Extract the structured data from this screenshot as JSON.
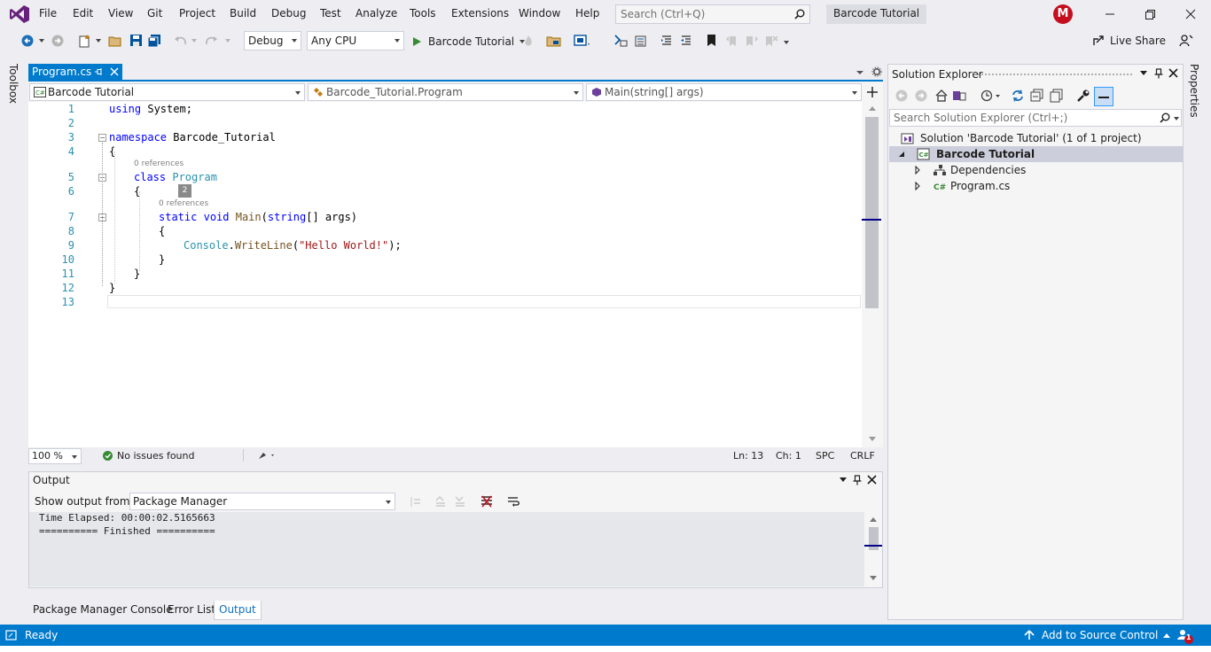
{
  "menu": {
    "items": [
      "File",
      "Edit",
      "View",
      "Git",
      "Project",
      "Build",
      "Debug",
      "Test",
      "Analyze",
      "Tools",
      "Extensions",
      "Window",
      "Help"
    ],
    "search_placeholder": "Search (Ctrl+Q)",
    "solution_name": "Barcode Tutorial",
    "avatar_initial": "M"
  },
  "toolbar": {
    "configuration": "Debug",
    "platform": "Any CPU",
    "run_target": "Barcode Tutorial",
    "live_share": "Live Share"
  },
  "side_strips": {
    "toolbox": "Toolbox",
    "properties": "Properties"
  },
  "editor": {
    "tab_label": "Program.cs",
    "nav_project": "Barcode Tutorial",
    "nav_type": "Barcode_Tutorial.Program",
    "nav_member": "Main(string[] args)",
    "line_numbers": [
      "1",
      "2",
      "3",
      "4",
      "5",
      "6",
      "7",
      "8",
      "9",
      "10",
      "11",
      "12",
      "13"
    ],
    "codelens_class": "0 references",
    "codelens_method": "0 references",
    "badge": "2",
    "code": {
      "l1_kw": "using",
      "l1_rest": " System;",
      "l3_kw": "namespace",
      "l3_rest": " Barcode_Tutorial",
      "l4": "{",
      "l5_kw": "class",
      "l5_type": "Program",
      "l6": "{",
      "l7_kw1": "static",
      "l7_kw2": "void",
      "l7_method": "Main",
      "l7_rest1": "(",
      "l7_kw3": "string",
      "l7_rest2": "[] args)",
      "l8": "{",
      "l9_type": "Console",
      "l9_dot": ".",
      "l9_method": "WriteLine",
      "l9_open": "(",
      "l9_str": "\"Hello World!\"",
      "l9_close": ");",
      "l10": "}",
      "l11": "}",
      "l12": "}"
    },
    "status": {
      "zoom": "100 %",
      "issues": "No issues found",
      "line": "Ln: 13",
      "col": "Ch: 1",
      "spc": "SPC",
      "crlf": "CRLF"
    }
  },
  "output": {
    "title": "Output",
    "show_from_label": "Show output from:",
    "source": "Package Manager",
    "lines": [
      "Time Elapsed: 00:00:02.5165663",
      "========== Finished =========="
    ]
  },
  "bottom_tabs": [
    "Package Manager Console",
    "Error List",
    "Output"
  ],
  "solution_explorer": {
    "title": "Solution Explorer",
    "search_placeholder": "Search Solution Explorer (Ctrl+;)",
    "solution_node": "Solution 'Barcode Tutorial' (1 of 1 project)",
    "project_node": "Barcode Tutorial",
    "dependencies": "Dependencies",
    "program_file": "Program.cs"
  },
  "statusbar": {
    "ready": "Ready",
    "source_control": "Add to Source Control",
    "notification_count": "1"
  },
  "colors": {
    "accent": "#007acc",
    "vs_purple": "#68217a",
    "avatar_red": "#c50f1f",
    "run_green": "#388a34"
  }
}
